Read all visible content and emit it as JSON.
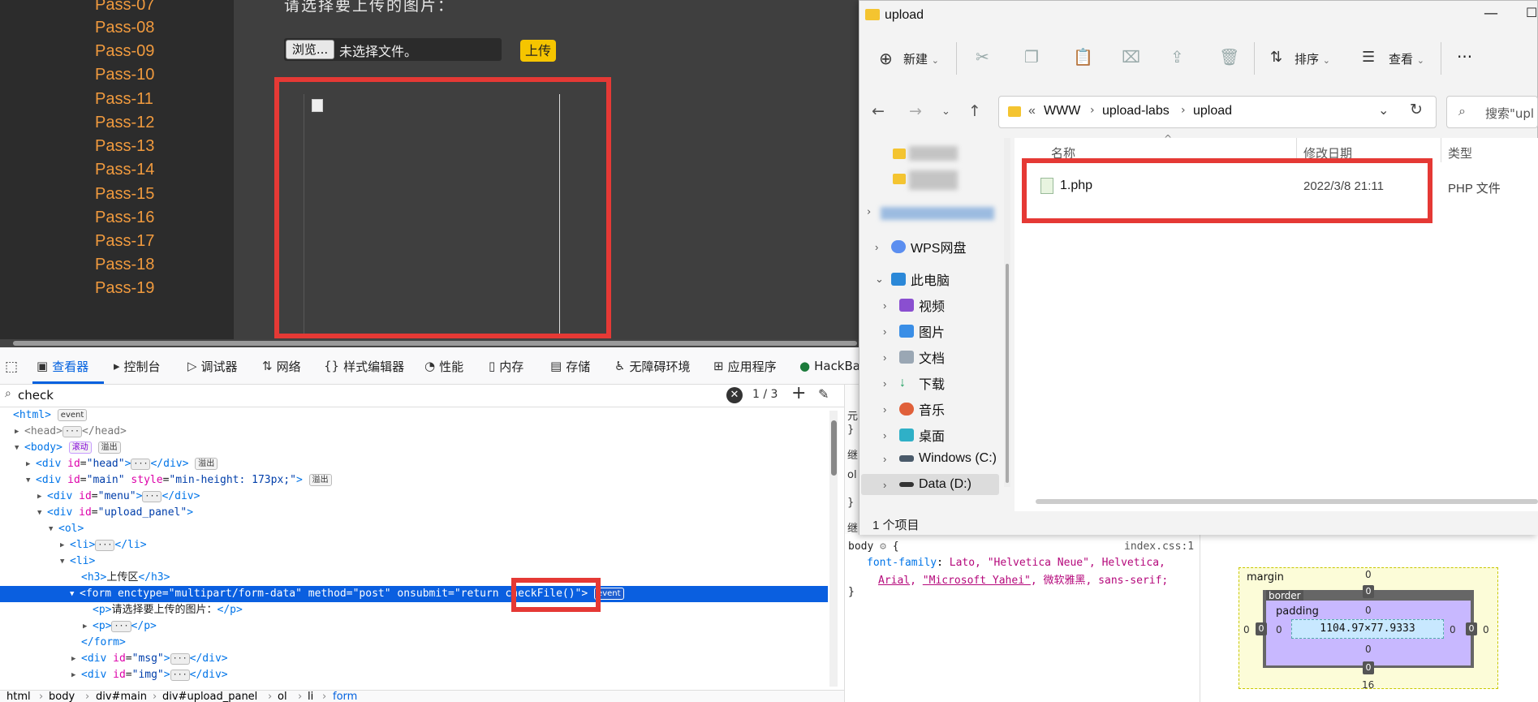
{
  "webpage": {
    "menu_items": [
      "Pass-07",
      "Pass-08",
      "Pass-09",
      "Pass-10",
      "Pass-11",
      "Pass-12",
      "Pass-13",
      "Pass-14",
      "Pass-15",
      "Pass-16",
      "Pass-17",
      "Pass-18",
      "Pass-19"
    ],
    "prompt_text": "请选择要上传的图片：",
    "browse_label": "浏览...",
    "no_file_text": "未选择文件。",
    "upload_label": "上传"
  },
  "devtools": {
    "tabs": [
      "查看器",
      "控制台",
      "调试器",
      "网络",
      "样式编辑器",
      "性能",
      "内存",
      "存储",
      "无障碍环境",
      "应用程序",
      "HackBar"
    ],
    "search_value": "check",
    "search_count": "1 / 3",
    "tree": {
      "l0": "html",
      "l1": "head",
      "l2": "body",
      "l3_attr": "id",
      "l3_val": "\"head\"",
      "l4_val": "\"main\"",
      "l4_style_attr": "style",
      "l4_style_val": "\"min-height: 173px;\"",
      "l5_val": "\"menu\"",
      "l6_val": "\"upload_panel\"",
      "l7": "ol",
      "l8": "li",
      "l9": "li",
      "l10_text": "上传区",
      "l11_enctype": "\"multipart/form-data\"",
      "l11_method": "\"post\"",
      "l11_onsubmit": "\"return checkFile()\"",
      "l12_text": "请选择要上传的图片：",
      "l13": "p",
      "l14": "/form",
      "l15_val": "\"msg\"",
      "l16_val": "\"img\""
    },
    "badges": {
      "event": "event",
      "scroll": "滚动",
      "overflow": "溢出"
    },
    "breadcrumb": [
      "html",
      "body",
      "div#main",
      "div#upload_panel",
      "ol",
      "li",
      "form"
    ]
  },
  "rules": {
    "selector": "body",
    "source": "index.css:1",
    "prop": "font-family",
    "values": "Lato, \"Helvetica Neue\", Helvetica,",
    "values2a": "Arial",
    "values2b": "\"Microsoft Yahei\"",
    "values2c": ", 微软雅黑, sans-serif;"
  },
  "boxmodel": {
    "margin_label": "margin",
    "border_label": "border",
    "padding_label": "padding",
    "content_size": "1104.97×77.9333",
    "zero": "0",
    "bottom_margin": "16"
  },
  "left_fragments": [
    "元",
    "}",
    "继",
    "ol",
    "}",
    "继"
  ],
  "explorer": {
    "title": "upload",
    "commands": {
      "new": "新建",
      "sort": "排序",
      "view": "查看",
      "more": "···"
    },
    "address": [
      "«",
      "WWW",
      "upload-labs",
      "upload"
    ],
    "search_placeholder": "搜索\"upl",
    "nav": {
      "wps": "WPS网盘",
      "pc": "此电脑",
      "video": "视频",
      "pictures": "图片",
      "docs": "文档",
      "downloads": "下载",
      "music": "音乐",
      "desktop": "桌面",
      "c": "Windows (C:)",
      "d": "Data (D:)"
    },
    "columns": {
      "name": "名称",
      "date": "修改日期",
      "type": "类型"
    },
    "file": {
      "name": "1.php",
      "date": "2022/3/8 21:11",
      "type": "PHP 文件"
    },
    "status": "1 个项目"
  },
  "colors": {
    "menu_orange": "#f09a3e",
    "highlight_red": "#e53935",
    "devtools_blue": "#0060df",
    "upload_yellow": "#f5c500"
  }
}
